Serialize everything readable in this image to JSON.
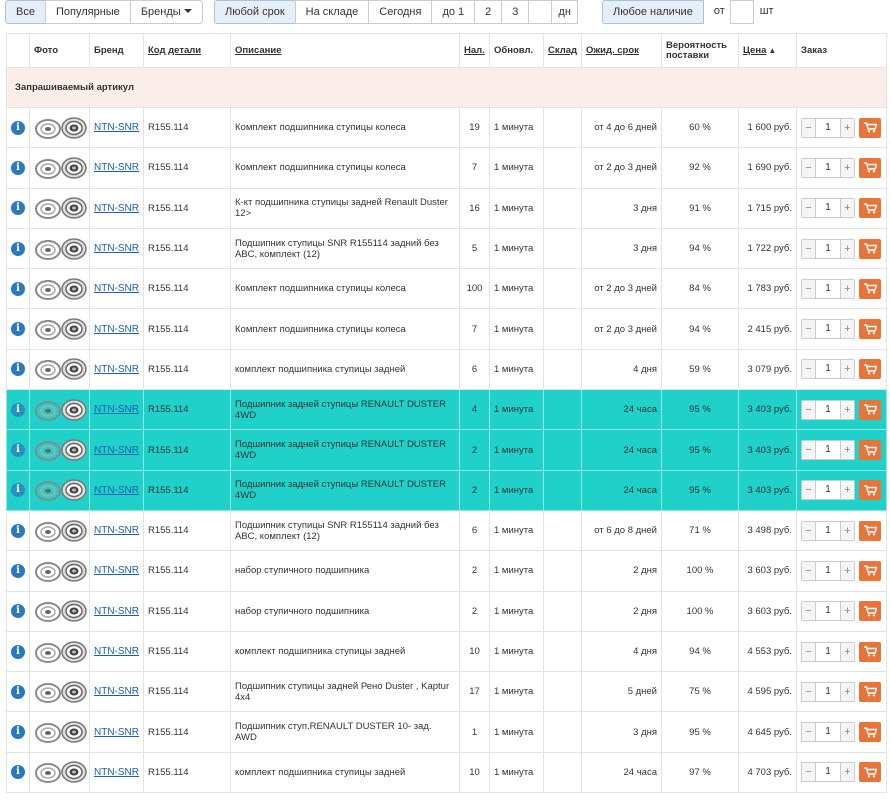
{
  "filters": {
    "brand_group": [
      "Все",
      "Популярные",
      "Бренды"
    ],
    "term_group": [
      "Любой срок",
      "На складе",
      "Сегодня",
      "до 1",
      "2",
      "3"
    ],
    "term_days_label": "дн",
    "availability_label": "Любое наличие",
    "from_label": "от",
    "units_label": "шт"
  },
  "table": {
    "headers": {
      "photo": "Фото",
      "brand": "Бренд",
      "code": "Код детали",
      "description": "Описание",
      "stock": "Нал.",
      "updated": "Обновл.",
      "warehouse": "Склад",
      "expected": "Ожид. срок",
      "probability": "Вероятность поставки",
      "price": "Цена",
      "price_sort": "▲",
      "order": "Заказ"
    },
    "group_label": "Запрашиваемый артикул",
    "rows": [
      {
        "brand": "NTN-SNR",
        "code": "R155.114",
        "desc": "Комплект подшипника ступицы колеса",
        "stock": "19",
        "updated": "1 минута",
        "expected": "от 4 до 6 дней",
        "prob": "60 %",
        "price": "1 600 руб.",
        "qty": "1",
        "highlight": false
      },
      {
        "brand": "NTN-SNR",
        "code": "R155.114",
        "desc": "Комплект подшипника ступицы колеса",
        "stock": "7",
        "updated": "1 минута",
        "expected": "от 2 до 3 дней",
        "prob": "92 %",
        "price": "1 690 руб.",
        "qty": "1",
        "highlight": false
      },
      {
        "brand": "NTN-SNR",
        "code": "R155.114",
        "desc": "К-кт подшипника ступицы задней Renault Duster 12>",
        "stock": "16",
        "updated": "1 минута",
        "expected": "3 дня",
        "prob": "91 %",
        "price": "1 715 руб.",
        "qty": "1",
        "highlight": false
      },
      {
        "brand": "NTN-SNR",
        "code": "R155.114",
        "desc": "Подшипник ступицы SNR R155114 задний без ABC, комплект (12)",
        "stock": "5",
        "updated": "1 минута",
        "expected": "3 дня",
        "prob": "94 %",
        "price": "1 722 руб.",
        "qty": "1",
        "highlight": false
      },
      {
        "brand": "NTN-SNR",
        "code": "R155.114",
        "desc": "Комплект подшипника ступицы колеса",
        "stock": "100",
        "updated": "1 минута",
        "expected": "от 2 до 3 дней",
        "prob": "84 %",
        "price": "1 783 руб.",
        "qty": "1",
        "highlight": false
      },
      {
        "brand": "NTN-SNR",
        "code": "R155.114",
        "desc": "Комплект подшипника ступицы колеса",
        "stock": "7",
        "updated": "1 минута",
        "expected": "от 2 до 3 дней",
        "prob": "94 %",
        "price": "2 415 руб.",
        "qty": "1",
        "highlight": false
      },
      {
        "brand": "NTN-SNR",
        "code": "R155.114",
        "desc": "комплект подшипника ступицы задней",
        "stock": "6",
        "updated": "1 минута",
        "expected": "4 дня",
        "prob": "59 %",
        "price": "3 079 руб.",
        "qty": "1",
        "highlight": false
      },
      {
        "brand": "NTN-SNR",
        "code": "R155.114",
        "desc": "Подшипник задней ступицы RENAULT DUSTER 4WD",
        "stock": "4",
        "updated": "1 минута",
        "expected": "24 часа",
        "prob": "95 %",
        "price": "3 403 руб.",
        "qty": "1",
        "highlight": true
      },
      {
        "brand": "NTN-SNR",
        "code": "R155.114",
        "desc": "Подшипник задней ступицы RENAULT DUSTER 4WD",
        "stock": "2",
        "updated": "1 минута",
        "expected": "24 часа",
        "prob": "95 %",
        "price": "3 403 руб.",
        "qty": "1",
        "highlight": true
      },
      {
        "brand": "NTN-SNR",
        "code": "R155.114",
        "desc": "Подшипник задней ступицы RENAULT DUSTER 4WD",
        "stock": "2",
        "updated": "1 минута",
        "expected": "24 часа",
        "prob": "95 %",
        "price": "3 403 руб.",
        "qty": "1",
        "highlight": true
      },
      {
        "brand": "NTN-SNR",
        "code": "R155.114",
        "desc": "Подшипник ступицы SNR R155114 задний без ABC, комплект (12)",
        "stock": "6",
        "updated": "1 минута",
        "expected": "от 6 до 8 дней",
        "prob": "71 %",
        "price": "3 498 руб.",
        "qty": "1",
        "highlight": false
      },
      {
        "brand": "NTN-SNR",
        "code": "R155.114",
        "desc": "набор ступичного подшипника",
        "stock": "2",
        "updated": "1 минута",
        "expected": "2 дня",
        "prob": "100 %",
        "price": "3 603 руб.",
        "qty": "1",
        "highlight": false
      },
      {
        "brand": "NTN-SNR",
        "code": "R155.114",
        "desc": "набор ступичного подшипника",
        "stock": "2",
        "updated": "1 минута",
        "expected": "2 дня",
        "prob": "100 %",
        "price": "3 603 руб.",
        "qty": "1",
        "highlight": false
      },
      {
        "brand": "NTN-SNR",
        "code": "R155.114",
        "desc": "комплект подшипника ступицы задней",
        "stock": "10",
        "updated": "1 минута",
        "expected": "4 дня",
        "prob": "94 %",
        "price": "4 553 руб.",
        "qty": "1",
        "highlight": false
      },
      {
        "brand": "NTN-SNR",
        "code": "R155.114",
        "desc": "Подшипник ступицы задней Рено Duster , Kaptur 4x4",
        "stock": "17",
        "updated": "1 минута",
        "expected": "5 дней",
        "prob": "75 %",
        "price": "4 595 руб.",
        "qty": "1",
        "highlight": false
      },
      {
        "brand": "NTN-SNR",
        "code": "R155.114",
        "desc": "Подшипник ступ.RENAULT DUSTER 10- зад. AWD",
        "stock": "1",
        "updated": "1 минута",
        "expected": "3 дня",
        "prob": "95 %",
        "price": "4 645 руб.",
        "qty": "1",
        "highlight": false
      },
      {
        "brand": "NTN-SNR",
        "code": "R155.114",
        "desc": "комплект подшипника ступицы задней",
        "stock": "10",
        "updated": "1 минута",
        "expected": "24 часа",
        "prob": "97 %",
        "price": "4 703 руб.",
        "qty": "1",
        "highlight": false
      }
    ]
  },
  "colors": {
    "highlight": "#1fd1c9",
    "group_bg": "#fbeeea",
    "link": "#1a5fb4",
    "info": "#2b78c2",
    "cart": "#e8743a"
  },
  "icons": {
    "info": "info-circle-icon",
    "cart": "shopping-cart-icon",
    "photo": "bearing-photo",
    "caret": "chevron-down-icon"
  }
}
